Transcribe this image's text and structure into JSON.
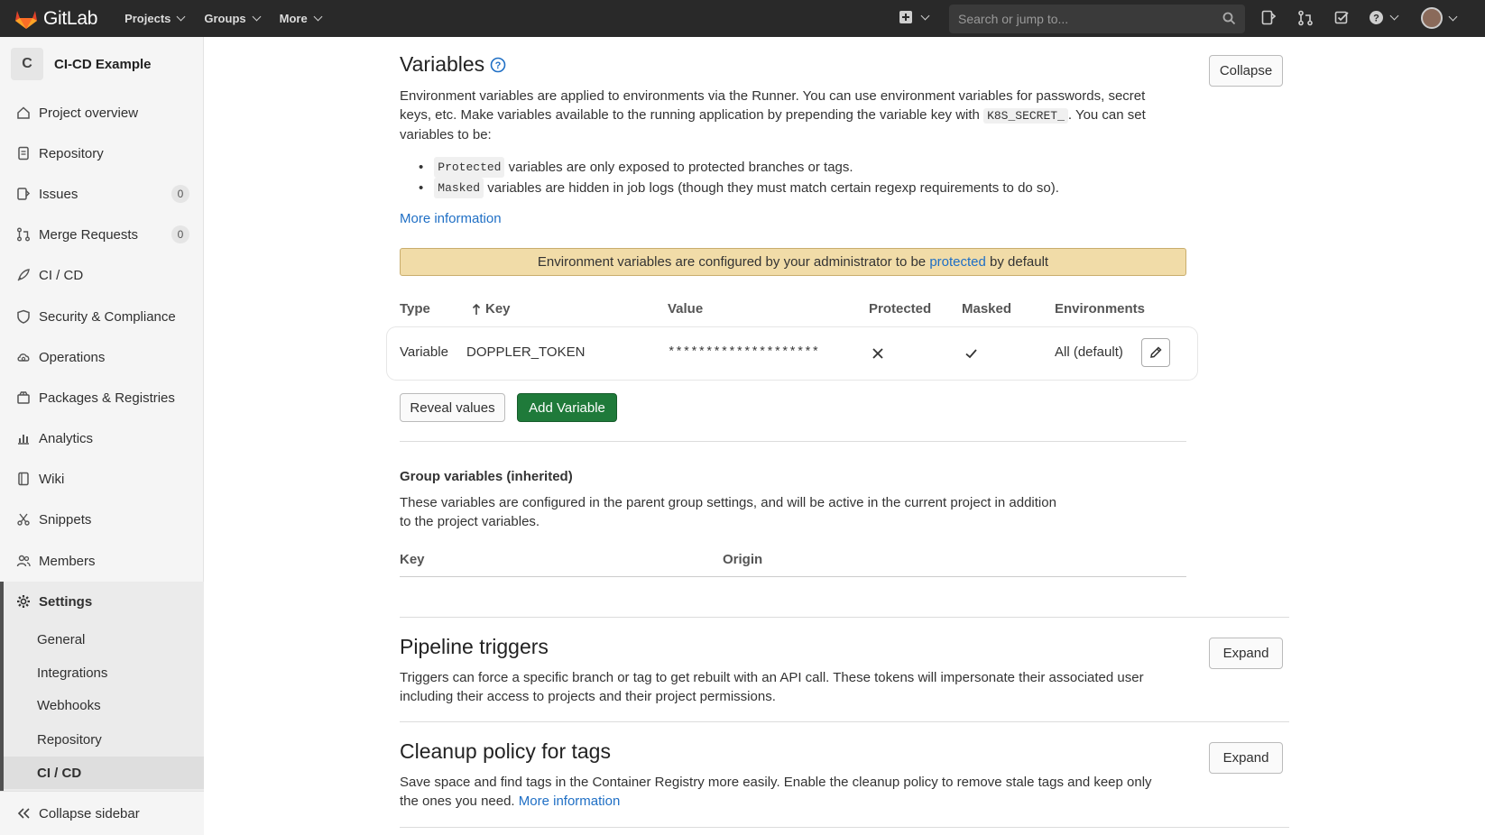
{
  "navbar": {
    "brand": "GitLab",
    "menu": [
      "Projects",
      "Groups",
      "More"
    ],
    "search_placeholder": "Search or jump to..."
  },
  "sidebar": {
    "project_initial": "C",
    "project_name": "CI-CD Example",
    "items": [
      {
        "label": "Project overview",
        "icon": "home-icon"
      },
      {
        "label": "Repository",
        "icon": "doc-icon"
      },
      {
        "label": "Issues",
        "icon": "issues-icon",
        "badge": "0"
      },
      {
        "label": "Merge Requests",
        "icon": "merge-request-icon",
        "badge": "0"
      },
      {
        "label": "CI / CD",
        "icon": "rocket-icon"
      },
      {
        "label": "Security & Compliance",
        "icon": "shield-icon"
      },
      {
        "label": "Operations",
        "icon": "cloud-gear-icon"
      },
      {
        "label": "Packages & Registries",
        "icon": "package-icon"
      },
      {
        "label": "Analytics",
        "icon": "chart-icon"
      },
      {
        "label": "Wiki",
        "icon": "book-icon"
      },
      {
        "label": "Snippets",
        "icon": "scissors-icon"
      },
      {
        "label": "Members",
        "icon": "users-icon"
      }
    ],
    "settings_label": "Settings",
    "settings_sub": [
      "General",
      "Integrations",
      "Webhooks",
      "Repository",
      "CI / CD"
    ],
    "collapse_label": "Collapse sidebar"
  },
  "variables": {
    "title": "Variables",
    "collapse_button": "Collapse",
    "intro_1": "Environment variables are applied to environments via the Runner. You can use environment variables for passwords, secret",
    "intro_2a": "keys, etc. Make variables available to the running application by prepending the variable key with",
    "intro_code": "K8S_SECRET_",
    "intro_2b": ". You can set",
    "intro_3": "variables to be:",
    "bullet_1_code": "Protected",
    "bullet_1_text": "variables are only exposed to protected branches or tags.",
    "bullet_2_code": "Masked",
    "bullet_2_text": "variables are hidden in job logs (though they must match certain regexp requirements to do so).",
    "more_info": "More information",
    "alert_pre": "Environment variables are configured by your administrator to be",
    "alert_link": "protected",
    "alert_post": "by default",
    "columns": [
      "Type",
      "Key",
      "Value",
      "Protected",
      "Masked",
      "Environments"
    ],
    "row": {
      "type": "Variable",
      "key": "DOPPLER_TOKEN",
      "value": "********************",
      "environments": "All (default)"
    },
    "reveal_button": "Reveal values",
    "add_button": "Add Variable"
  },
  "group_variables": {
    "title": "Group variables (inherited)",
    "desc_1": "These variables are configured in the parent group settings, and will be active in the current project in addition",
    "desc_2": "to the project variables.",
    "columns": [
      "Key",
      "Origin"
    ]
  },
  "pipeline_triggers": {
    "title": "Pipeline triggers",
    "expand_button": "Expand",
    "desc_1": "Triggers can force a specific branch or tag to get rebuilt with an API call. These tokens will impersonate their associated user",
    "desc_2": "including their access to projects and their project permissions."
  },
  "cleanup": {
    "title": "Cleanup policy for tags",
    "expand_button": "Expand",
    "desc_1": "Save space and find tags in the Container Registry more easily. Enable the cleanup policy to remove stale tags and keep only",
    "desc_2": "the ones you need.",
    "more_info": "More information"
  },
  "colors": {
    "navbar": "#292929",
    "link": "#1f6fc5",
    "alert_bg": "#f1dca8",
    "add_button": "#1f7a3a"
  }
}
